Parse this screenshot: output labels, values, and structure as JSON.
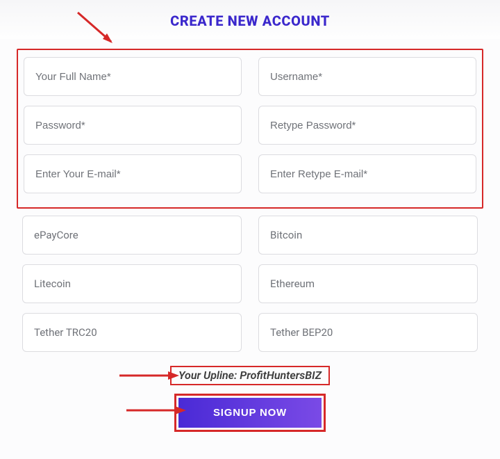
{
  "title": "CREATE NEW ACCOUNT",
  "fields": {
    "full_name_ph": "Your Full Name*",
    "username_ph": "Username*",
    "password_ph": "Password*",
    "retype_password_ph": "Retype Password*",
    "email_ph": "Enter Your E-mail*",
    "retype_email_ph": "Enter Retype E-mail*"
  },
  "options": {
    "epaycore": "ePayCore",
    "bitcoin": "Bitcoin",
    "litecoin": "Litecoin",
    "ethereum": "Ethereum",
    "tether_trc20": "Tether TRC20",
    "tether_bep20": "Tether BEP20"
  },
  "upline": "Your Upline: ProfitHuntersBIZ",
  "signup_label": "SIGNUP NOW",
  "colors": {
    "accent": "#3b28cc",
    "annotate": "#d62828",
    "button_grad_a": "#4a2ad6",
    "button_grad_b": "#7a4ae6"
  }
}
